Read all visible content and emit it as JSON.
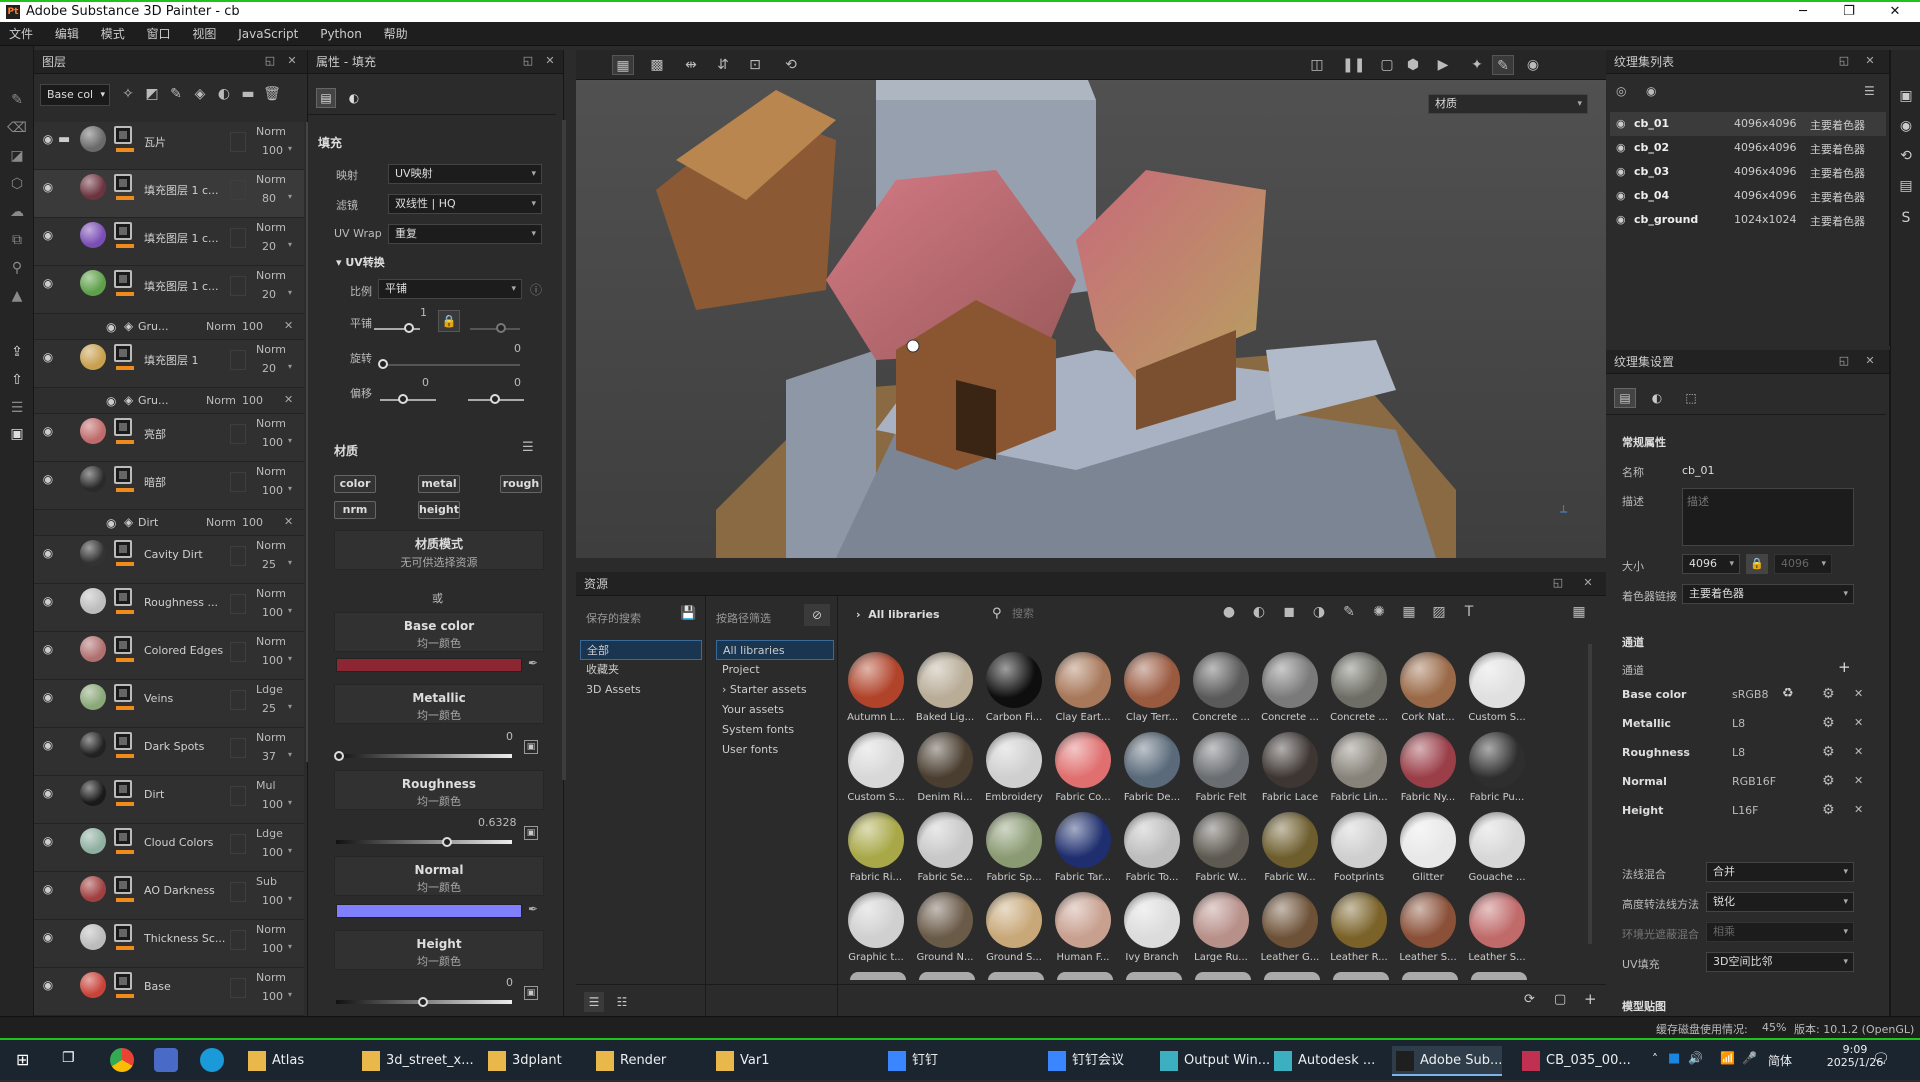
{
  "window": {
    "title": "Adobe Substance 3D Painter - cb",
    "app_badge": "Pt",
    "min": "─",
    "max": "❐",
    "close": "✕"
  },
  "menu": [
    "文件",
    "编辑",
    "模式",
    "窗口",
    "视图",
    "JavaScript",
    "Python",
    "帮助"
  ],
  "layers": {
    "title": "图层",
    "channel_select": "Base col",
    "rows": [
      {
        "name": "瓦片",
        "blend": "Norm",
        "opacity": "100",
        "thumb": "#6a6a6a",
        "folder": true,
        "selected": false
      },
      {
        "name": "填充图层 1 c...",
        "blend": "Norm",
        "opacity": "80",
        "thumb": "#6c3440",
        "selected": true
      },
      {
        "name": "填充图层 1 c...",
        "blend": "Norm",
        "opacity": "20",
        "thumb": "#7a4fb5",
        "selected": false
      },
      {
        "name": "填充图层 1 c...",
        "blend": "Norm",
        "opacity": "20",
        "thumb": "#5ea04a",
        "selected": false
      },
      {
        "name": "填充图层 1",
        "blend": "Norm",
        "opacity": "20",
        "thumb": "#c8a050",
        "selected": false
      },
      {
        "name": "亮部",
        "blend": "Norm",
        "opacity": "100",
        "thumb": "#c06b6b",
        "selected": false
      },
      {
        "name": "暗部",
        "blend": "Norm",
        "opacity": "100",
        "thumb": "#2a2a2a",
        "selected": false
      },
      {
        "name": "Cavity Dirt",
        "blend": "Norm",
        "opacity": "25",
        "thumb": "#333",
        "selected": false
      },
      {
        "name": "Roughness ...",
        "blend": "Norm",
        "opacity": "100",
        "thumb": "#bdbdbd",
        "selected": false
      },
      {
        "name": "Colored Edges",
        "blend": "Norm",
        "opacity": "100",
        "thumb": "#b07070",
        "selected": false
      },
      {
        "name": "Veins",
        "blend": "Ldge",
        "opacity": "25",
        "thumb": "#8aa878",
        "selected": false
      },
      {
        "name": "Dark Spots",
        "blend": "Norm",
        "opacity": "37",
        "thumb": "#222",
        "selected": false
      },
      {
        "name": "Dirt",
        "blend": "Mul",
        "opacity": "100",
        "thumb": "#1a1a1a",
        "selected": false
      },
      {
        "name": "Cloud Colors",
        "blend": "Ldge",
        "opacity": "100",
        "thumb": "#8fb0a0",
        "selected": false
      },
      {
        "name": "AO Darkness",
        "blend": "Sub",
        "opacity": "100",
        "thumb": "#a04040",
        "selected": false
      },
      {
        "name": "Thickness Sc...",
        "blend": "Norm",
        "opacity": "100",
        "thumb": "#bbbbbb",
        "selected": false
      },
      {
        "name": "Base",
        "blend": "Norm",
        "opacity": "100",
        "thumb": "#c8443a",
        "selected": false
      },
      {
        "name": "",
        "blend": "Norm",
        "opacity": "",
        "thumb": "#555",
        "selected": false
      }
    ],
    "subrows": [
      {
        "name": "Gru...",
        "blend": "Norm",
        "opacity": "100"
      },
      {
        "name": "Gru...",
        "blend": "Norm",
        "opacity": "100"
      },
      {
        "name": "Dirt",
        "blend": "Norm",
        "opacity": "100"
      }
    ]
  },
  "props": {
    "title": "属性 - 填充",
    "fill": "填充",
    "mapping_label": "映射",
    "mapping_value": "UV映射",
    "filter_label": "滤镜",
    "filter_value": "双线性 | HQ",
    "uvwrap_label": "UV Wrap",
    "uvwrap_value": "重复",
    "uvtransform": "UV转换",
    "scale_label": "比例",
    "scale_value": "平铺",
    "tile_label": "平铺",
    "tile_value": "1",
    "rotate_label": "旋转",
    "rotate_value": "0",
    "offset_label": "偏移",
    "offset_x": "0",
    "offset_y": "0",
    "material": "材质",
    "chips": [
      "color",
      "metal",
      "rough",
      "nrm",
      "height"
    ],
    "matmode_title": "材质模式",
    "matmode_sub": "无可供选择资源",
    "or": "或",
    "basecolor_title": "Base color",
    "uniform": "均一颜色",
    "metallic_title": "Metallic",
    "metallic_value": "0",
    "roughness_title": "Roughness",
    "roughness_value": "0.6328",
    "normal_title": "Normal",
    "height_title": "Height",
    "height_value": "0",
    "basecolor_hex": "#8c2632",
    "normal_hex": "#8080ff"
  },
  "viewport": {
    "mode": "材质"
  },
  "assets": {
    "title": "资源",
    "saved_search": "保存的搜索",
    "path_filter": "按路径筛选",
    "breadcrumb": "All libraries",
    "search_placeholder": "搜索",
    "left": [
      "全部",
      "收藏夹",
      "3D Assets"
    ],
    "libs": [
      "All libraries",
      "Project",
      "Starter assets",
      "Your assets",
      "System fonts",
      "User fonts"
    ],
    "materials": [
      {
        "n": "Autumn L...",
        "c": "#b0432a"
      },
      {
        "n": "Baked Lig...",
        "c": "#b9ad98"
      },
      {
        "n": "Carbon Fi...",
        "c": "#0e0e0e"
      },
      {
        "n": "Clay Eart...",
        "c": "#a8785a"
      },
      {
        "n": "Clay Terr...",
        "c": "#9a5a40"
      },
      {
        "n": "Concrete ...",
        "c": "#5a5a5a"
      },
      {
        "n": "Concrete ...",
        "c": "#7a7a7a"
      },
      {
        "n": "Concrete ...",
        "c": "#6e6e66"
      },
      {
        "n": "Cork Nat...",
        "c": "#9a6a48"
      },
      {
        "n": "Custom S...",
        "c": "#e0e0e0"
      },
      {
        "n": "Custom S...",
        "c": "#d8d8d8"
      },
      {
        "n": "Denim Ri...",
        "c": "#4a3e30"
      },
      {
        "n": "Embroidery",
        "c": "#cfcfcf"
      },
      {
        "n": "Fabric Co...",
        "c": "#e07070"
      },
      {
        "n": "Fabric De...",
        "c": "#5a6a7a"
      },
      {
        "n": "Fabric Felt",
        "c": "#6a6e72"
      },
      {
        "n": "Fabric Lace",
        "c": "#3e3633"
      },
      {
        "n": "Fabric Lin...",
        "c": "#88837a"
      },
      {
        "n": "Fabric Ny...",
        "c": "#9a3e48"
      },
      {
        "n": "Fabric Pu...",
        "c": "#2e2e2e"
      },
      {
        "n": "Fabric Ri...",
        "c": "#a8a848"
      },
      {
        "n": "Fabric Se...",
        "c": "#c8c8c8"
      },
      {
        "n": "Fabric Sp...",
        "c": "#8a9a72"
      },
      {
        "n": "Fabric Tar...",
        "c": "#1e2e6e"
      },
      {
        "n": "Fabric To...",
        "c": "#bdbdbd"
      },
      {
        "n": "Fabric W...",
        "c": "#5e5a52"
      },
      {
        "n": "Fabric W...",
        "c": "#6e5e2e"
      },
      {
        "n": "Footprints",
        "c": "#cfcfcf"
      },
      {
        "n": "Glitter",
        "c": "#e8e8e8"
      },
      {
        "n": "Gouache ...",
        "c": "#d8d8d8"
      },
      {
        "n": "Graphic t...",
        "c": "#d0d0d0"
      },
      {
        "n": "Ground N...",
        "c": "#6a5a48"
      },
      {
        "n": "Ground S...",
        "c": "#c8a878"
      },
      {
        "n": "Human F...",
        "c": "#c8a090"
      },
      {
        "n": "Ivy Branch",
        "c": "#dcdcdc"
      },
      {
        "n": "Large Ru...",
        "c": "#b8908a"
      },
      {
        "n": "Leather G...",
        "c": "#6e5238"
      },
      {
        "n": "Leather R...",
        "c": "#7a6228"
      },
      {
        "n": "Leather S...",
        "c": "#8a5038"
      },
      {
        "n": "Leather S...",
        "c": "#c06a6a"
      }
    ]
  },
  "texsets": {
    "title": "纹理集列表",
    "rows": [
      {
        "name": "cb_01",
        "size": "4096x4096",
        "shader": "主要着色器",
        "selected": true
      },
      {
        "name": "cb_02",
        "size": "4096x4096",
        "shader": "主要着色器",
        "selected": false
      },
      {
        "name": "cb_03",
        "size": "4096x4096",
        "shader": "主要着色器",
        "selected": false
      },
      {
        "name": "cb_04",
        "size": "4096x4096",
        "shader": "主要着色器",
        "selected": false
      },
      {
        "name": "cb_ground",
        "size": "1024x1024",
        "shader": "主要着色器",
        "selected": false
      }
    ]
  },
  "tsettings": {
    "title": "纹理集设置",
    "general": "常规属性",
    "name_label": "名称",
    "name_value": "cb_01",
    "desc_label": "描述",
    "desc_placeholder": "描述",
    "size_label": "大小",
    "size_value": "4096",
    "size_locked": "4096",
    "shader_label": "着色器链接",
    "shader_value": "主要着色器",
    "channels_h": "通道",
    "channel_label": "通道",
    "channels": [
      {
        "name": "Base color",
        "fmt": "sRGB8"
      },
      {
        "name": "Metallic",
        "fmt": "L8"
      },
      {
        "name": "Roughness",
        "fmt": "L8"
      },
      {
        "name": "Normal",
        "fmt": "RGB16F"
      },
      {
        "name": "Height",
        "fmt": "L16F"
      }
    ],
    "normal_mix_label": "法线混合",
    "normal_mix_value": "合并",
    "height_method_label": "高度转法线方法",
    "height_method_value": "锐化",
    "ao_mix_label": "环境光遮蔽混合",
    "ao_mix_value": "相乘",
    "uv_label": "UV填充",
    "uv_value": "3D空间比邻",
    "model_maps": "模型贴图"
  },
  "status": {
    "left": "缓存磁盘使用情况:",
    "pct": "45%",
    "version": "版本: 10.1.2 (OpenGL)"
  },
  "taskbar": {
    "items": [
      {
        "label": "Atlas",
        "color": "#e8b84a"
      },
      {
        "label": "3d_street_x...",
        "color": "#e8b84a"
      },
      {
        "label": "3dplant",
        "color": "#e8b84a"
      },
      {
        "label": "Render",
        "color": "#e8b84a"
      },
      {
        "label": "Var1",
        "color": "#e8b84a"
      },
      {
        "label": "钉钉",
        "color": "#3a86ff"
      },
      {
        "label": "钉钉会议",
        "color": "#3a86ff"
      },
      {
        "label": "Output Win...",
        "color": "#3cb0c0"
      },
      {
        "label": "Autodesk ...",
        "color": "#3cb0c0"
      },
      {
        "label": "Adobe Sub...",
        "color": "#1f1f1f"
      },
      {
        "label": "CB_035_00...",
        "color": "#c03050"
      }
    ],
    "ime": "简体",
    "time": "9:09",
    "date": "2025/1/26"
  }
}
